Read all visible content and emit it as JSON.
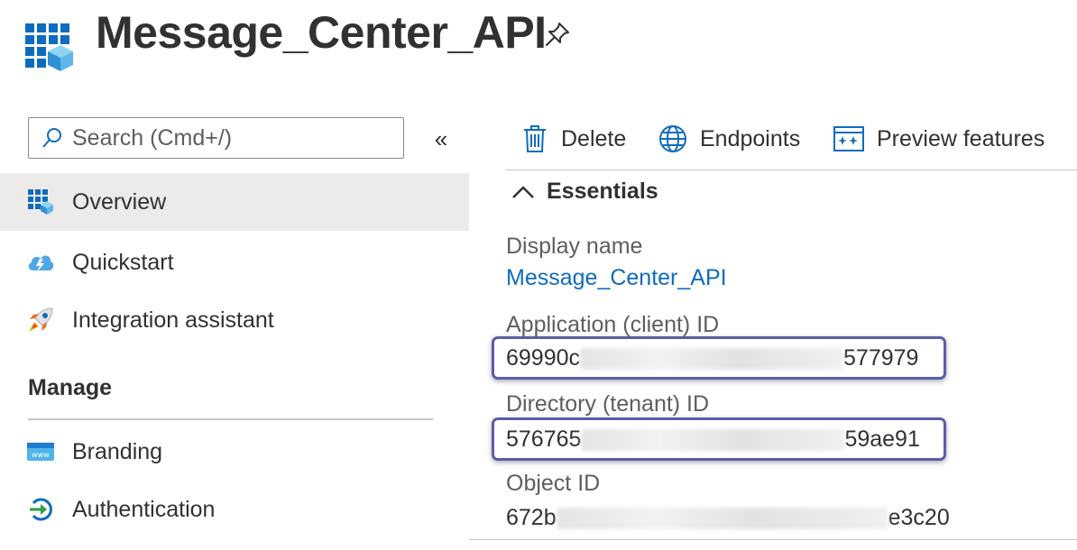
{
  "header": {
    "title": "Message_Center_API",
    "app_icon": "app-registration-grid-icon",
    "pin_icon": "pin-icon"
  },
  "sidebar": {
    "search_placeholder": "Search (Cmd+/)",
    "collapse_glyph": "«",
    "items": [
      {
        "label": "Overview",
        "icon": "overview-grid-icon",
        "selected": true
      },
      {
        "label": "Quickstart",
        "icon": "cloud-lightning-icon",
        "selected": false
      },
      {
        "label": "Integration assistant",
        "icon": "rocket-icon",
        "selected": false
      }
    ],
    "section": "Manage",
    "manage_items": [
      {
        "label": "Branding",
        "icon": "branding-window-icon"
      },
      {
        "label": "Authentication",
        "icon": "authentication-arrow-icon"
      }
    ]
  },
  "toolbar": {
    "delete_label": "Delete",
    "endpoints_label": "Endpoints",
    "preview_label": "Preview features"
  },
  "essentials": {
    "heading": "Essentials",
    "display_name_label": "Display name",
    "display_name_value": "Message_Center_API",
    "app_id_label": "Application (client) ID",
    "app_id_prefix": "69990c",
    "app_id_suffix": "577979",
    "tenant_id_label": "Directory (tenant) ID",
    "tenant_id_prefix": "576765",
    "tenant_id_suffix": "59ae91",
    "object_id_label": "Object ID",
    "object_id_prefix": "672b",
    "object_id_suffix": "e3c20"
  },
  "colors": {
    "accent": "#0f6cbd",
    "highlight_border": "#5b5ea6",
    "selected_bg": "#edebe9"
  }
}
